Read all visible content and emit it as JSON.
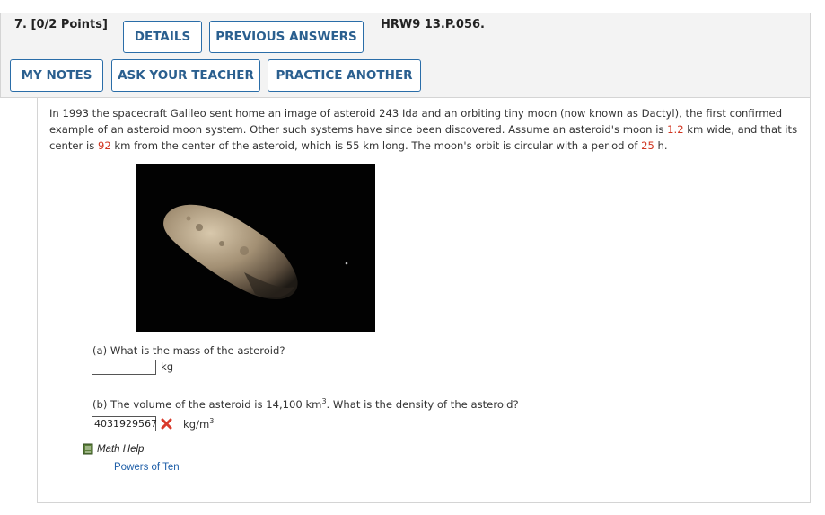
{
  "header": {
    "question_number": "7.",
    "points": "[0/2 Points]",
    "buttons": {
      "details": "DETAILS",
      "previous_answers": "PREVIOUS ANSWERS",
      "my_notes": "MY NOTES",
      "ask_teacher": "ASK YOUR TEACHER",
      "practice_another": "PRACTICE ANOTHER"
    },
    "problem_code": "HRW9 13.P.056."
  },
  "problem": {
    "text_1": "In 1993 the spacecraft Galileo sent home an image of asteroid 243 Ida and an orbiting tiny moon (now known as Dactyl), the first confirmed example of an asteroid moon system. Other such systems have since been discovered. Assume an asteroid's moon is ",
    "moon_width": "1.2",
    "text_2": " km wide, and that its center is ",
    "distance": "92",
    "text_3": " km from the center of the asteroid, which is 55 km long. The moon's orbit is circular with a period of ",
    "period": "25",
    "text_4": " h."
  },
  "part_a": {
    "question": "(a) What is the mass of the asteroid?",
    "value": "",
    "unit": "kg"
  },
  "part_b": {
    "question_1": "(b) The volume of the asteroid is 14,100 km",
    "question_sup": "3",
    "question_2": ". What is the density of the asteroid?",
    "value": "4031929567",
    "unit": "kg/m",
    "unit_sup": "3",
    "status": "incorrect"
  },
  "math_help": {
    "label": "Math Help",
    "link": "Powers of Ten"
  },
  "colors": {
    "button_text": "#2a5f8f",
    "button_border": "#2a6da8",
    "highlight_red": "#d0341f",
    "link": "#1f5fa8"
  }
}
